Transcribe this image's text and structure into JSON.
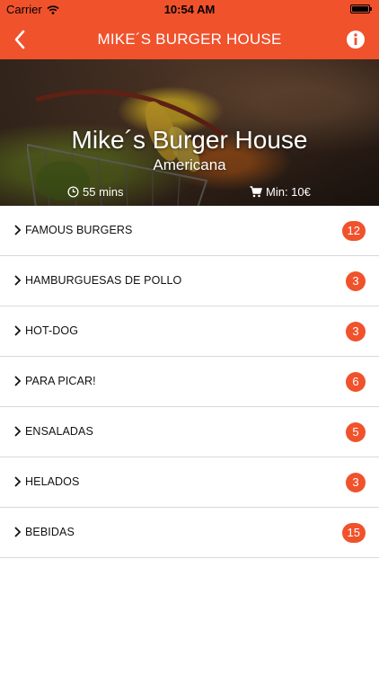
{
  "status_bar": {
    "carrier": "Carrier",
    "time": "10:54 AM"
  },
  "nav": {
    "title": "MIKE´S BURGER HOUSE",
    "back_icon": "chevron-left-icon",
    "info_icon": "info-icon"
  },
  "restaurant": {
    "name": "Mike´s Burger House",
    "cuisine": "Americana",
    "delivery_time": "55 mins",
    "minimum_order": "Min: 10€"
  },
  "categories": [
    {
      "label": "FAMOUS BURGERS",
      "count": "12"
    },
    {
      "label": "HAMBURGUESAS DE POLLO",
      "count": "3"
    },
    {
      "label": "HOT-DOG",
      "count": "3"
    },
    {
      "label": "PARA PICAR!",
      "count": "6"
    },
    {
      "label": "ENSALADAS",
      "count": "5"
    },
    {
      "label": "HELADOS",
      "count": "3"
    },
    {
      "label": "BEBIDAS",
      "count": "15"
    }
  ],
  "colors": {
    "accent": "#f0522c"
  }
}
